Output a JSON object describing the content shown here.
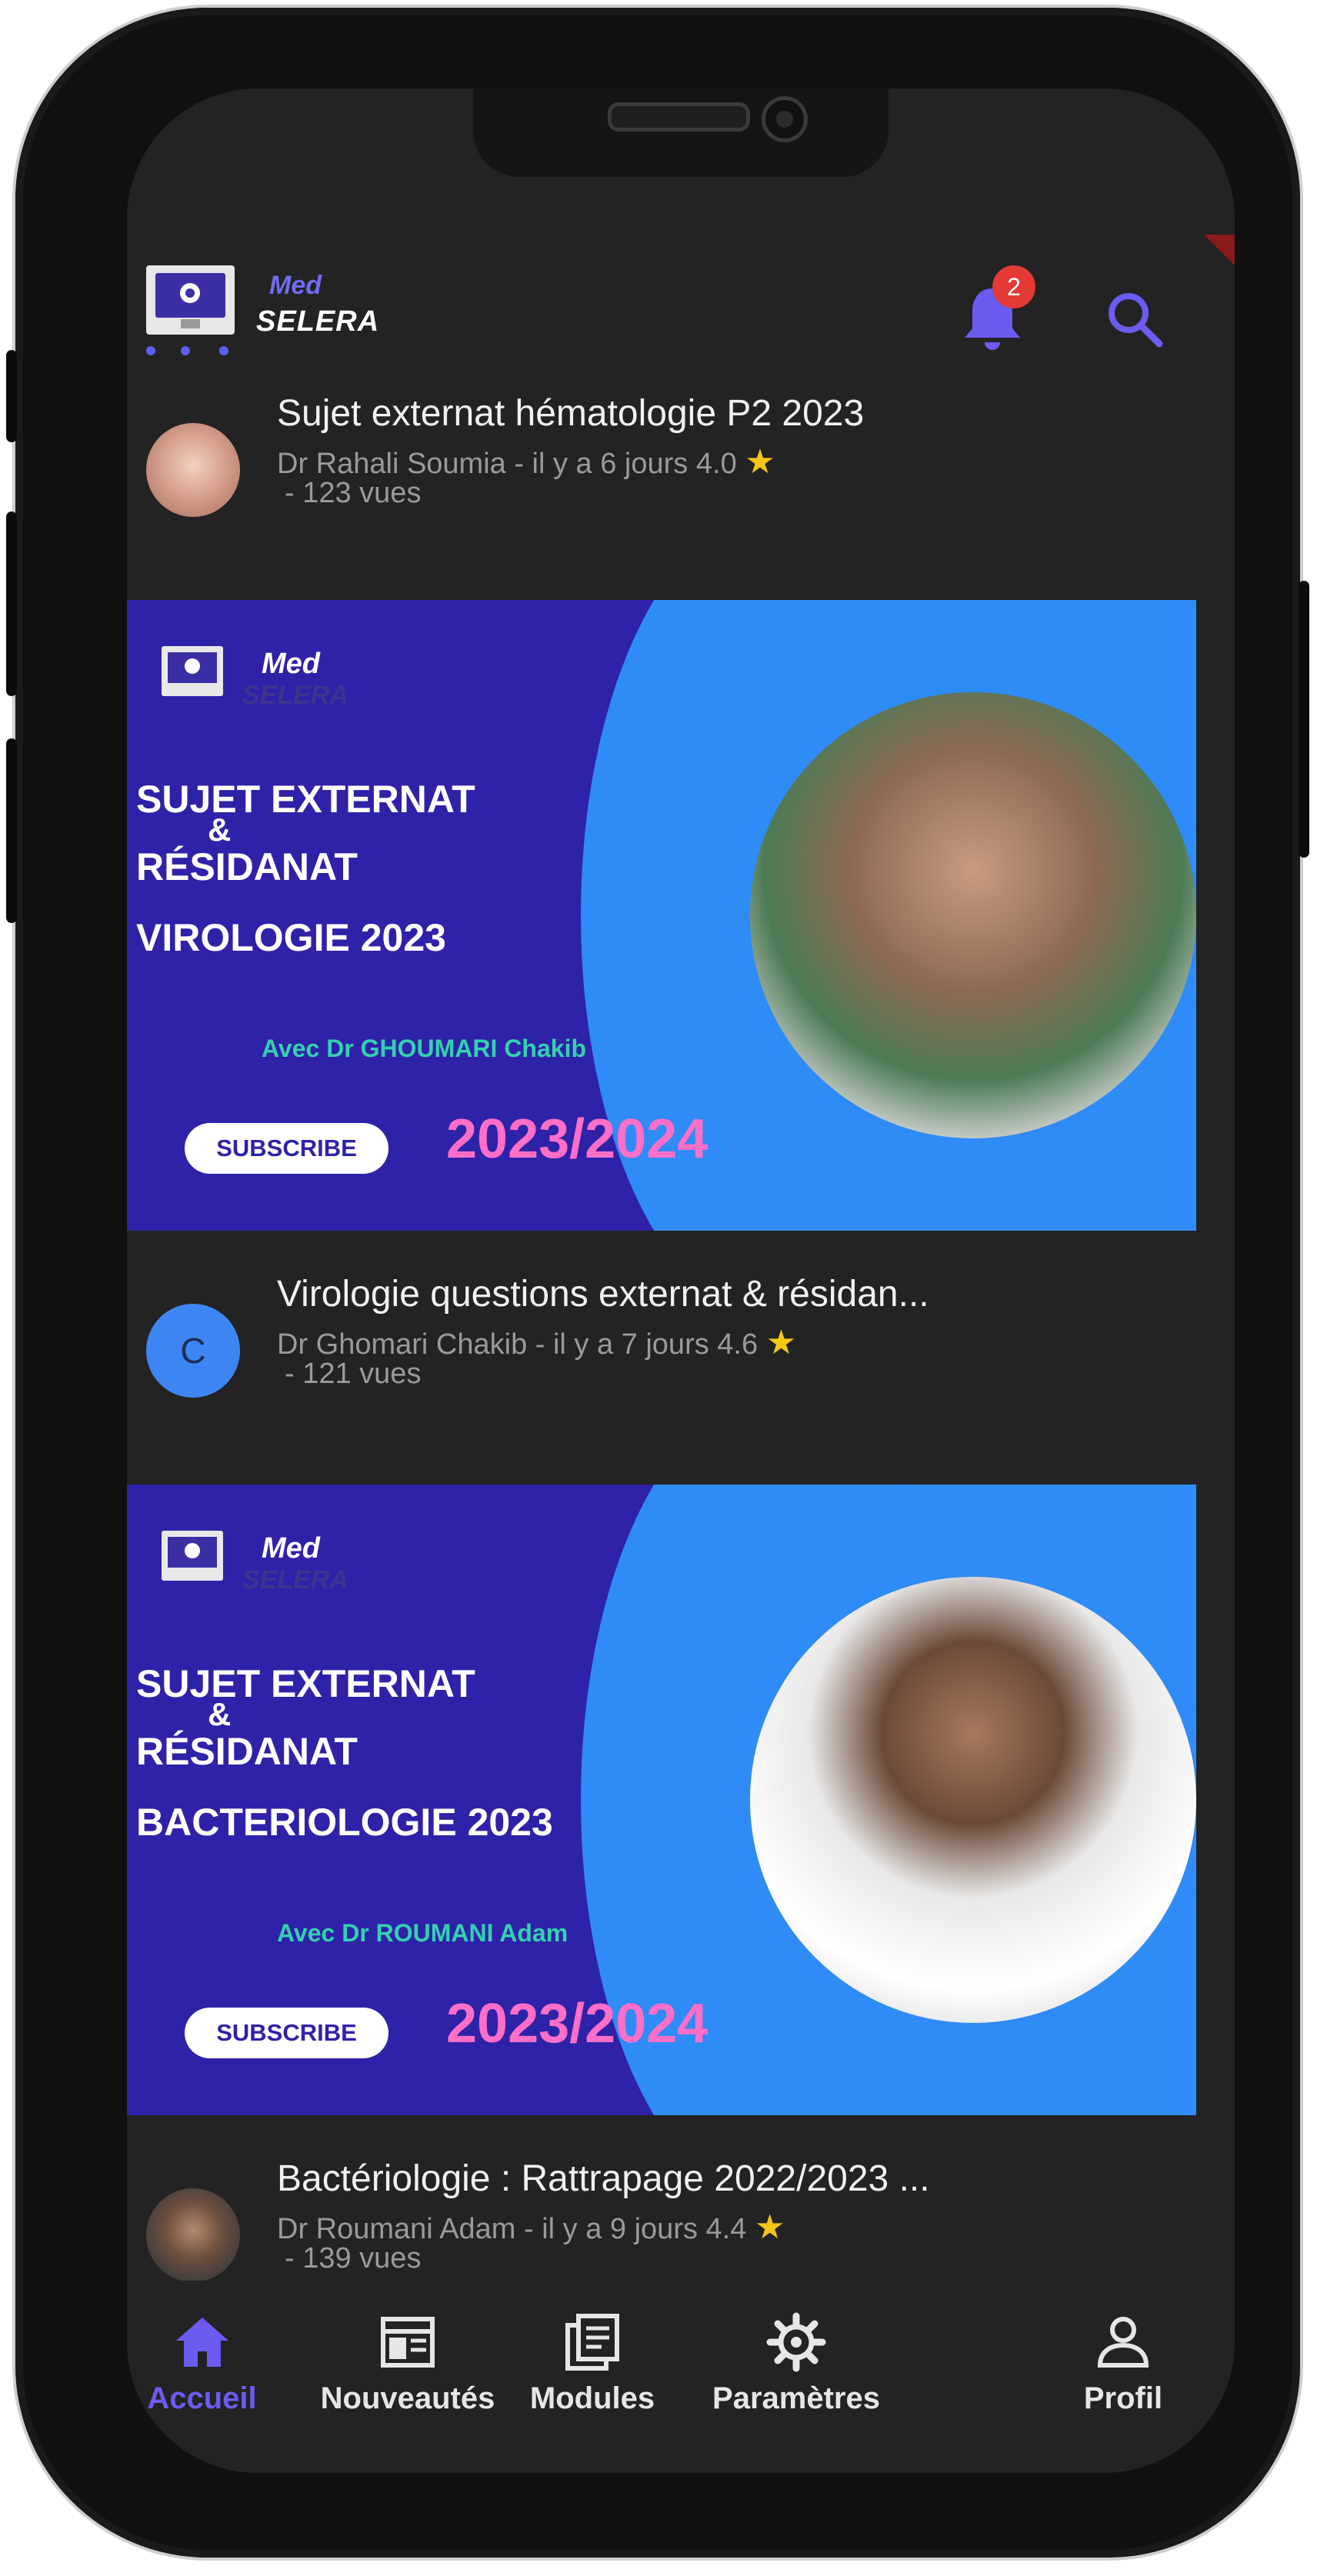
{
  "header": {
    "brand_top": "Med",
    "brand_bottom": "SELERA",
    "notification_count": "2"
  },
  "feed": [
    {
      "title": "Sujet externat hématologie P2 2023",
      "author_time": "Dr Rahali Soumia - il y a 6 jours",
      "rating": "4.0",
      "views": "- 123 vues"
    },
    {
      "thumb": {
        "brand_top": "Med",
        "brand_bottom": "SELERA",
        "line1": "SUJET EXTERNAT",
        "line2": "&",
        "line3": "RÉSIDANAT",
        "line4": "VIROLOGIE 2023",
        "avec": "Avec Dr GHOUMARI Chakib",
        "subscribe": "SUBSCRIBE",
        "year": "2023/2024"
      },
      "avatar_letter": "C",
      "title": "Virologie questions externat & résidan...",
      "author_time": "Dr Ghomari Chakib - il y a 7 jours",
      "rating": "4.6",
      "views": "- 121 vues"
    },
    {
      "thumb": {
        "brand_top": "Med",
        "brand_bottom": "SELERA",
        "line1": "SUJET EXTERNAT",
        "line2": "&",
        "line3": "RÉSIDANAT",
        "line4": "BACTERIOLOGIE 2023",
        "avec": "Avec Dr ROUMANI Adam",
        "subscribe": "SUBSCRIBE",
        "year": "2023/2024"
      },
      "title": "Bactériologie : Rattrapage 2022/2023 ...",
      "author_time": "Dr Roumani Adam - il y a 9 jours",
      "rating": "4.4",
      "views": "- 139 vues"
    }
  ],
  "nav": [
    {
      "label": "Accueil",
      "icon": "home-icon",
      "active": true
    },
    {
      "label": "Nouveautés",
      "icon": "newspaper-icon",
      "active": false
    },
    {
      "label": "Modules",
      "icon": "library-icon",
      "active": false
    },
    {
      "label": "Paramètres",
      "icon": "gear-icon",
      "active": false
    },
    {
      "label": "Profil",
      "icon": "user-icon",
      "active": false
    }
  ],
  "colors": {
    "accent": "#6b5bf0",
    "background": "#232323",
    "thumb_purple": "#2e22a8",
    "thumb_blue": "#2f8bf5",
    "star": "#f5c518",
    "badge": "#e53935"
  }
}
